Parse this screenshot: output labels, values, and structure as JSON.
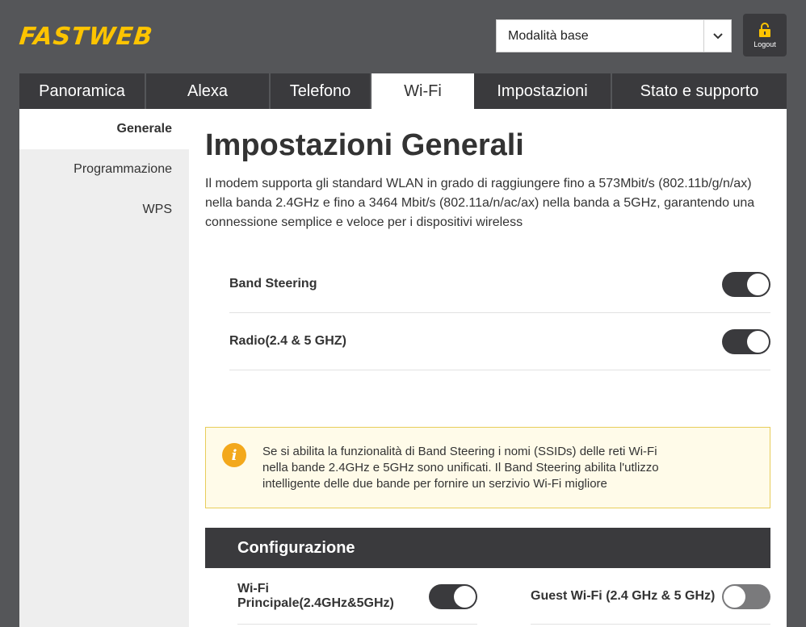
{
  "header": {
    "logo_text": "FASTWEB",
    "mode_select": {
      "value": "Modalità base"
    },
    "logout_label": "Logout"
  },
  "tabs": [
    {
      "label": "Panoramica"
    },
    {
      "label": "Alexa"
    },
    {
      "label": "Telefono"
    },
    {
      "label": "Wi-Fi",
      "active": true
    },
    {
      "label": "Impostazioni"
    },
    {
      "label": "Stato e supporto"
    }
  ],
  "sidebar": {
    "items": [
      {
        "label": "Generale",
        "active": true
      },
      {
        "label": "Programmazione"
      },
      {
        "label": "WPS"
      }
    ]
  },
  "main": {
    "title": "Impostazioni Generali",
    "description": "Il modem supporta gli standard WLAN in grado di raggiungere fino a 573Mbit/s (802.11b/g/n/ax) nella banda 2.4GHz e fino a 3464 Mbit/s (802.11a/n/ac/ax) nella banda a 5GHz, garantendo una connessione semplice e veloce per i dispositivi wireless",
    "settings": [
      {
        "label": "Band Steering",
        "enabled": true
      },
      {
        "label": "Radio(2.4 & 5 GHZ)",
        "enabled": true
      }
    ],
    "info": {
      "line1": "Se si abilita la funzionalità di Band Steering i nomi (SSIDs) delle reti Wi-Fi",
      "line2": "nella bande 2.4GHz e 5GHz sono unificati. Il Band Steering abilita l'utlizzo",
      "line3": "intelligente delle due bande per fornire un serzivio Wi-Fi migliore"
    },
    "config": {
      "title": "Configurazione",
      "items": [
        {
          "label": "Wi-Fi Principale(2.4GHz&5GHz)",
          "enabled": true
        },
        {
          "label": "Guest Wi-Fi (2.4 GHz & 5 GHz)",
          "enabled": false
        }
      ]
    }
  },
  "colors": {
    "brand_yellow": "#fdc400",
    "dark": "#3a3a3d",
    "header_bg": "#555659",
    "info_icon": "#f3a81c"
  }
}
